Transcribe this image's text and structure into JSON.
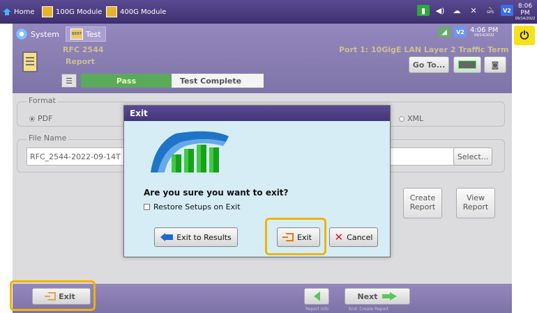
{
  "topbar": {
    "home_label": "Home",
    "tab1_label": "100G Module",
    "tab2_label": "400G Module",
    "gps_label": "GPS",
    "v2_label": "V2",
    "time": "8:06 PM",
    "date": "09/14/2022"
  },
  "app": {
    "system_label": "System",
    "test_label": "Test",
    "badge_text": "BERT",
    "clock_time": "4:06 PM",
    "clock_date": "09/14/2022",
    "v2_label": "V2",
    "test_name": "RFC 2544",
    "section": "Report",
    "port": "Port 1: 10GigE LAN Layer 2 Traffic Term",
    "goto_label": "Go To...",
    "status_pass": "Pass",
    "status_complete": "Test Complete"
  },
  "form": {
    "format_label": "Format",
    "option_pdf": "PDF",
    "option_xml": "XML",
    "filename_label": "File Name",
    "filename_value": "RFC_2544-2022-09-14T",
    "select_label": "Select...",
    "create_report_label": "Create Report",
    "view_report_label": "View Report"
  },
  "bottom": {
    "exit_label": "Exit",
    "next_label": "Next",
    "prev_caption": "Report Info",
    "next_caption": "End: Create Report"
  },
  "modal": {
    "title": "Exit",
    "question": "Are you sure you want to exit?",
    "restore_label": "Restore Setups on Exit",
    "exit_to_results_label": "Exit to Results",
    "exit_label": "Exit",
    "cancel_label": "Cancel"
  },
  "colors": {
    "header_purple": "#4e3f86",
    "pass_green": "#1c8a1c",
    "highlight": "#f0b400",
    "modal_bg": "#d6edf6",
    "power_yellow": "#f6e21a"
  }
}
